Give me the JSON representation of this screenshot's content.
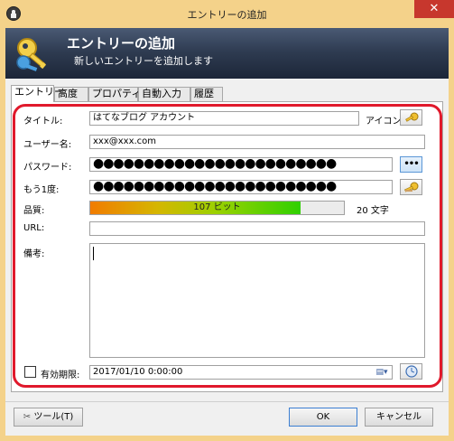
{
  "window": {
    "title": "エントリーの追加",
    "close_glyph": "✕"
  },
  "banner": {
    "title": "エントリーの追加",
    "subtitle": "新しいエントリーを追加します"
  },
  "tabs": [
    {
      "label": "エントリー",
      "active": true
    },
    {
      "label": "高度"
    },
    {
      "label": "プロパティ"
    },
    {
      "label": "自動入力"
    },
    {
      "label": "履歴"
    }
  ],
  "form": {
    "title_label": "タイトル:",
    "title_value": "はてなブログ アカウント",
    "icon_label": "アイコン:",
    "username_label": "ユーザー名:",
    "username_value": "xxx@xxx.com",
    "password_label": "パスワード:",
    "password_value": "●●●●●●●●●●●●●●●●●●●●●●●●",
    "show_password_label": "•••",
    "repeat_label": "もう1度:",
    "repeat_value": "●●●●●●●●●●●●●●●●●●●●●●●●",
    "quality_label": "品質:",
    "quality_text": "107 ビット",
    "quality_fraction": 0.83,
    "char_count": "20 文字",
    "url_label": "URL:",
    "url_value": "",
    "notes_label": "備考:",
    "notes_value": "",
    "expiry_label": "有効期限:",
    "expiry_checked": false,
    "expiry_value": "2017/01/10   0:00:00"
  },
  "footer": {
    "tools_label": "ツール(T)",
    "ok_label": "OK",
    "cancel_label": "キャンセル"
  },
  "colors": {
    "highlight_frame": "#e0192c",
    "banner_top": "#4a5a74",
    "banner_bottom": "#1c2638",
    "title_bar": "#f4d28a"
  }
}
